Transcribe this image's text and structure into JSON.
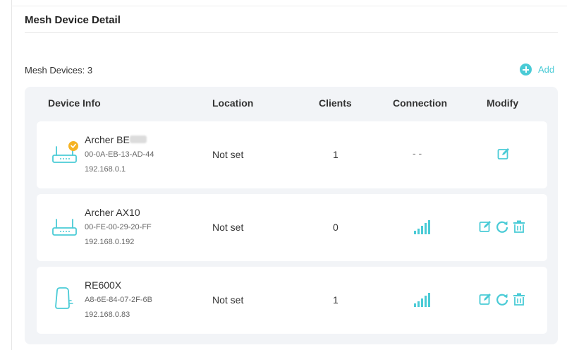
{
  "section": {
    "title": "Mesh Device Detail",
    "devices_count_label": "Mesh Devices: 3",
    "add_label": "Add"
  },
  "colors": {
    "accent": "#4acbd6",
    "warning_badge": "#f5b324",
    "panel_bg": "#f2f4f7"
  },
  "table": {
    "headers": {
      "device_info": "Device Info",
      "location": "Location",
      "clients": "Clients",
      "connection": "Connection",
      "modify": "Modify"
    },
    "rows": [
      {
        "icon": "router-warning-icon",
        "name": "Archer BE",
        "mac": "00-0A-EB-13-AD-44",
        "ip": "192.168.0.1",
        "location": "Not set",
        "clients": "1",
        "connection": "- -",
        "actions": [
          "edit-icon"
        ]
      },
      {
        "icon": "router-icon",
        "name": "Archer AX10",
        "mac": "00-FE-00-29-20-FF",
        "ip": "192.168.0.192",
        "location": "Not set",
        "clients": "0",
        "connection": "signal-strong-icon",
        "actions": [
          "edit-icon",
          "refresh-icon",
          "trash-icon"
        ]
      },
      {
        "icon": "range-extender-icon",
        "name": "RE600X",
        "mac": "A8-6E-84-07-2F-6B",
        "ip": "192.168.0.83",
        "location": "Not set",
        "clients": "1",
        "connection": "signal-strong-icon",
        "actions": [
          "edit-icon",
          "refresh-icon",
          "trash-icon"
        ]
      }
    ]
  }
}
